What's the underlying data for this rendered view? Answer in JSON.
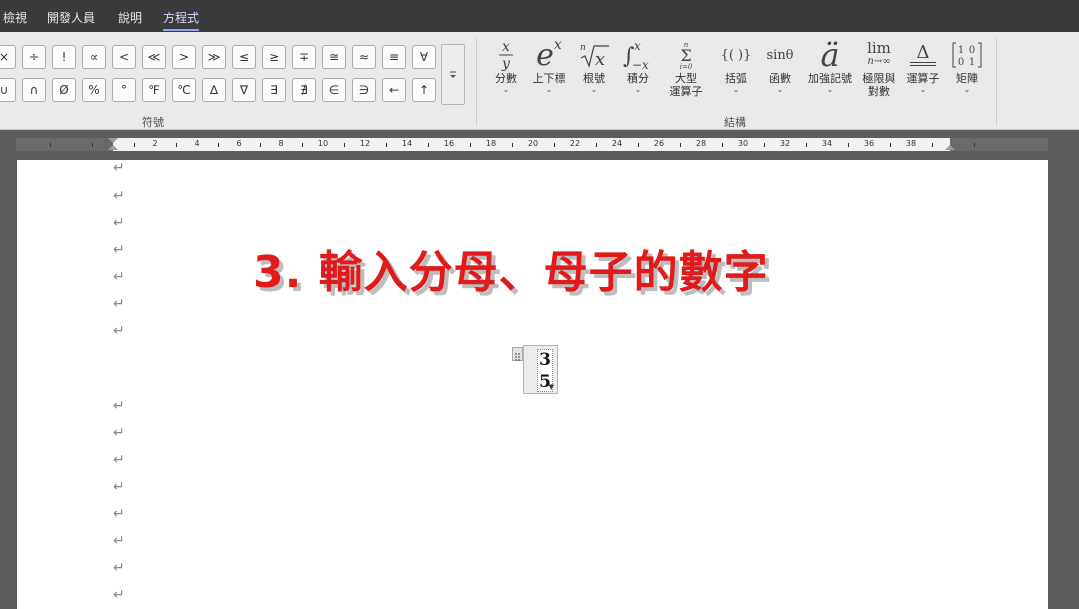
{
  "menu": [
    {
      "label": "檢視",
      "active": false
    },
    {
      "label": "開發人員",
      "active": false
    },
    {
      "label": "說明",
      "active": false
    },
    {
      "label": "方程式",
      "active": true
    }
  ],
  "symbols": {
    "row1": [
      "×",
      "÷",
      "!",
      "∝",
      "<",
      "≪",
      ">",
      "≫",
      "≤",
      "≥",
      "∓",
      "≅",
      "≈",
      "≡",
      "∀"
    ],
    "row2": [
      "∪",
      "∩",
      "Ø",
      "%",
      "°",
      "℉",
      "℃",
      "∆",
      "∇",
      "∃",
      "∄",
      "∈",
      "∋",
      "←",
      "↑"
    ],
    "more_icon": "expand-gallery-icon",
    "group_label": "符號"
  },
  "structures": {
    "group_label": "結構",
    "buttons": [
      {
        "icon": "fraction-icon",
        "label": "分數"
      },
      {
        "icon": "script-icon",
        "label": "上下標"
      },
      {
        "icon": "radical-icon",
        "label": "根號"
      },
      {
        "icon": "integral-icon",
        "label": "積分"
      },
      {
        "icon": "large-operator-icon",
        "label": "大型\n運算子"
      },
      {
        "icon": "bracket-icon",
        "label": "括弧"
      },
      {
        "icon": "function-icon",
        "label": "函數"
      },
      {
        "icon": "accent-icon",
        "label": "加強記號"
      },
      {
        "icon": "limit-log-icon",
        "label": "極限與\n對數"
      },
      {
        "icon": "operator-icon",
        "label": "運算子"
      },
      {
        "icon": "matrix-icon",
        "label": "矩陣"
      }
    ],
    "icon_text": {
      "function": "sinθ",
      "limit_top": "lim",
      "limit_bottom": "n→∞",
      "bracket": "{( )}",
      "accent": "ä",
      "operator": "Δ",
      "exp_base": "e",
      "exp_sup": "x"
    }
  },
  "ruler": {
    "numbers": [
      "2",
      "4",
      "6",
      "8",
      "10",
      "12",
      "14",
      "16",
      "18",
      "20",
      "22",
      "24",
      "26",
      "28",
      "30",
      "32",
      "34",
      "36",
      "38"
    ]
  },
  "document": {
    "headline": "3. 輸入分母、母子的數字",
    "paragraph_mark": "↵",
    "equation": {
      "numerator": "3",
      "denominator": "5"
    }
  }
}
